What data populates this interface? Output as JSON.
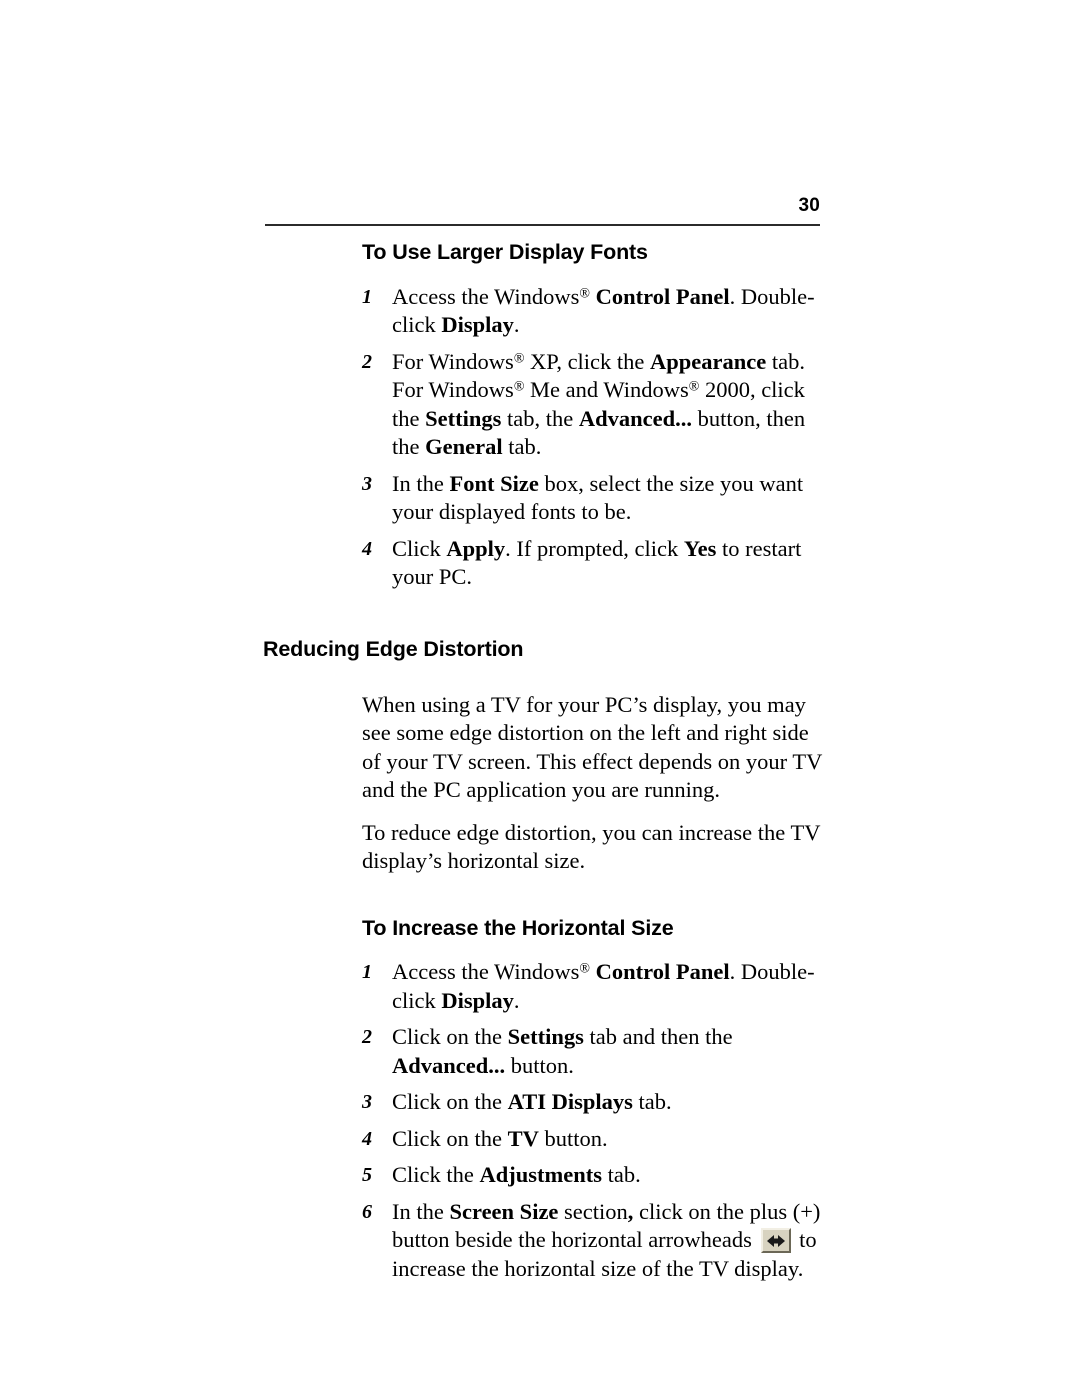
{
  "header": {
    "page_number": "30"
  },
  "sections": [
    {
      "id": "use-larger-display-fonts",
      "heading": "To Use Larger Display Fonts",
      "heading_level": "sub",
      "steps": [
        {
          "number": "1",
          "parts": [
            {
              "text": "Access the Windows",
              "style": "normal"
            },
            {
              "text": "®",
              "style": "superscript"
            },
            {
              "text": " ",
              "style": "normal"
            },
            {
              "text": "Control Panel",
              "style": "bold"
            },
            {
              "text": ". Double-click ",
              "style": "normal"
            },
            {
              "text": "Display",
              "style": "bold"
            },
            {
              "text": ".",
              "style": "normal"
            }
          ]
        },
        {
          "number": "2",
          "parts": [
            {
              "text": "For Windows",
              "style": "normal"
            },
            {
              "text": "®",
              "style": "superscript"
            },
            {
              "text": " XP, click the ",
              "style": "normal"
            },
            {
              "text": "Appearance",
              "style": "bold"
            },
            {
              "text": " tab. For Windows",
              "style": "normal"
            },
            {
              "text": "®",
              "style": "superscript"
            },
            {
              "text": " Me and Windows",
              "style": "normal"
            },
            {
              "text": "®",
              "style": "superscript"
            },
            {
              "text": " 2000, click the ",
              "style": "normal"
            },
            {
              "text": "Settings",
              "style": "bold"
            },
            {
              "text": " tab, the ",
              "style": "normal"
            },
            {
              "text": "Advanced...",
              "style": "bold"
            },
            {
              "text": " button, then the ",
              "style": "normal"
            },
            {
              "text": "General",
              "style": "bold"
            },
            {
              "text": " tab.",
              "style": "normal"
            }
          ]
        },
        {
          "number": "3",
          "parts": [
            {
              "text": "In the ",
              "style": "normal"
            },
            {
              "text": "Font Size",
              "style": "bold"
            },
            {
              "text": " box, select the size you want your displayed fonts to be.",
              "style": "normal"
            }
          ]
        },
        {
          "number": "4",
          "parts": [
            {
              "text": "Click ",
              "style": "normal"
            },
            {
              "text": "Apply",
              "style": "bold"
            },
            {
              "text": ". If prompted, click ",
              "style": "normal"
            },
            {
              "text": "Yes",
              "style": "bold"
            },
            {
              "text": " to restart your PC.",
              "style": "normal"
            }
          ]
        }
      ]
    },
    {
      "id": "reducing-edge-distortion",
      "heading": "Reducing Edge Distortion",
      "heading_level": "section",
      "paragraphs": [
        "When using a TV for your PC’s display, you may see some edge distortion on the left and right side of your TV screen. This effect depends on your TV and the PC application you are running.",
        "To reduce edge distortion, you can increase the TV display’s horizontal size."
      ]
    },
    {
      "id": "increase-horizontal-size",
      "heading": "To Increase the Horizontal Size",
      "heading_level": "sub",
      "steps": [
        {
          "number": "1",
          "parts": [
            {
              "text": "Access the Windows",
              "style": "normal"
            },
            {
              "text": "®",
              "style": "superscript"
            },
            {
              "text": " ",
              "style": "normal"
            },
            {
              "text": "Control Panel",
              "style": "bold"
            },
            {
              "text": ". Double-click ",
              "style": "normal"
            },
            {
              "text": "Display",
              "style": "bold"
            },
            {
              "text": ".",
              "style": "normal"
            }
          ]
        },
        {
          "number": "2",
          "parts": [
            {
              "text": "Click on the ",
              "style": "normal"
            },
            {
              "text": "Settings",
              "style": "bold"
            },
            {
              "text": " tab and then the ",
              "style": "normal"
            },
            {
              "text": "Advanced...",
              "style": "bold"
            },
            {
              "text": " button.",
              "style": "normal"
            }
          ]
        },
        {
          "number": "3",
          "parts": [
            {
              "text": "Click on the ",
              "style": "normal"
            },
            {
              "text": "ATI Displays",
              "style": "bold"
            },
            {
              "text": " tab.",
              "style": "normal"
            }
          ]
        },
        {
          "number": "4",
          "parts": [
            {
              "text": "Click on the ",
              "style": "normal"
            },
            {
              "text": "TV",
              "style": "bold"
            },
            {
              "text": " button.",
              "style": "normal"
            }
          ]
        },
        {
          "number": "5",
          "parts": [
            {
              "text": "Click the ",
              "style": "normal"
            },
            {
              "text": "Adjustments",
              "style": "bold"
            },
            {
              "text": " tab.",
              "style": "normal"
            }
          ]
        },
        {
          "number": "6",
          "parts": [
            {
              "text": "In the ",
              "style": "normal"
            },
            {
              "text": "Screen Size",
              "style": "bold"
            },
            {
              "text": " section",
              "style": "normal"
            },
            {
              "text": ",",
              "style": "bold"
            },
            {
              "text": " click on the plus (+) button beside the horizontal arrowheads ",
              "style": "normal"
            },
            {
              "icon": "horizontal-arrowheads-button-icon"
            },
            {
              "text": " to increase the horizontal size of the TV display.",
              "style": "normal"
            }
          ]
        }
      ]
    }
  ],
  "icons": {
    "horizontal_arrowheads_button": {
      "name": "horizontal-arrowheads-button-icon",
      "face_color": "#d8d3c0",
      "highlight_color": "#f2efe4",
      "shadow_color": "#6b6756",
      "glyph_color": "#1a1a1a"
    }
  }
}
